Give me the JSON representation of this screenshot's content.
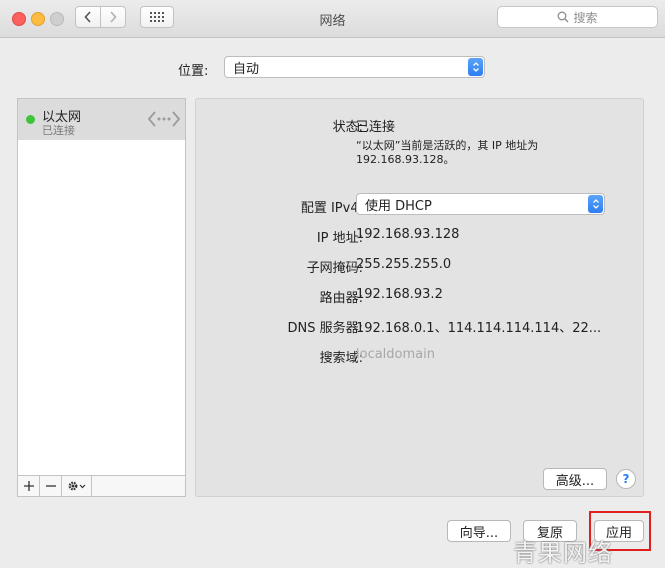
{
  "window": {
    "title": "网络"
  },
  "toolbar": {
    "search_placeholder": "搜索"
  },
  "location": {
    "label": "位置:",
    "value": "自动"
  },
  "services": [
    {
      "name": "以太网",
      "status": "已连接",
      "status_color": "#3ec33a"
    }
  ],
  "service_toolbar": {
    "add": "+",
    "remove": "—"
  },
  "detail": {
    "status_label": "状态:",
    "status_value": "已连接",
    "status_note_1": "“以太网”当前是活跃的，其 IP 地址为",
    "status_note_2": "192.168.93.128。",
    "config_label": "配置 IPv4:",
    "config_value": "使用 DHCP",
    "ip_label": "IP 地址:",
    "ip_value": "192.168.93.128",
    "mask_label": "子网掩码:",
    "mask_value": "255.255.255.0",
    "router_label": "路由器:",
    "router_value": "192.168.93.2",
    "dns_label": "DNS 服务器:",
    "dns_value": "192.168.0.1、114.114.114.114、22...",
    "search_domain_label": "搜索域:",
    "search_domain_value": "localdomain",
    "advanced_button": "高级...",
    "help_button": "?"
  },
  "footer": {
    "assist_button": "向导...",
    "revert_button": "复原",
    "apply_button": "应用"
  },
  "watermark": "青果网络",
  "colors": {
    "accent": "#2d7ef2",
    "connected": "#3ec33a",
    "highlight": "#e02020"
  }
}
